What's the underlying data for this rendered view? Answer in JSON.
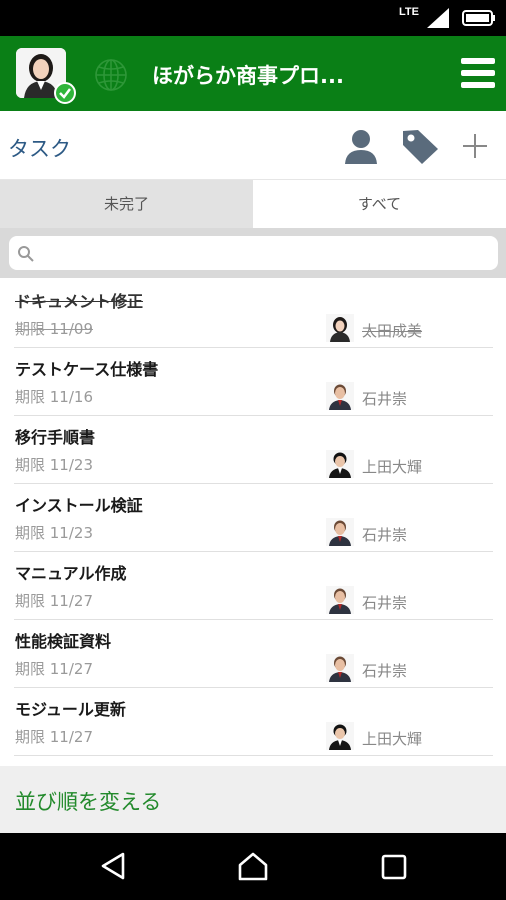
{
  "status_bar": {
    "network": "LTE"
  },
  "app_bar": {
    "title": "ほがらか商事プロ...",
    "accent_color": "#0a7f16"
  },
  "task_header": {
    "title": "タスク"
  },
  "tabs": [
    {
      "label": "未完了",
      "selected": false
    },
    {
      "label": "すべて",
      "selected": true
    }
  ],
  "search": {
    "placeholder": "",
    "value": ""
  },
  "tasks": [
    {
      "name": "ドキュメント修正",
      "due": "期限 11/09",
      "assignee": "太田成美",
      "avatar": "female-avatar",
      "completed": true
    },
    {
      "name": "テストケース仕様書",
      "due": "期限 11/16",
      "assignee": "石井崇",
      "avatar": "male-suit-avatar",
      "completed": false
    },
    {
      "name": "移行手順書",
      "due": "期限 11/23",
      "assignee": "上田大輝",
      "avatar": "male-young-avatar",
      "completed": false
    },
    {
      "name": "インストール検証",
      "due": "期限 11/23",
      "assignee": "石井崇",
      "avatar": "male-suit-avatar",
      "completed": false
    },
    {
      "name": "マニュアル作成",
      "due": "期限 11/27",
      "assignee": "石井崇",
      "avatar": "male-suit-avatar",
      "completed": false
    },
    {
      "name": "性能検証資料",
      "due": "期限 11/27",
      "assignee": "石井崇",
      "avatar": "male-suit-avatar",
      "completed": false
    },
    {
      "name": "モジュール更新",
      "due": "期限 11/27",
      "assignee": "上田大輝",
      "avatar": "male-young-avatar",
      "completed": false
    }
  ],
  "sort": {
    "label": "並び順を変える"
  }
}
